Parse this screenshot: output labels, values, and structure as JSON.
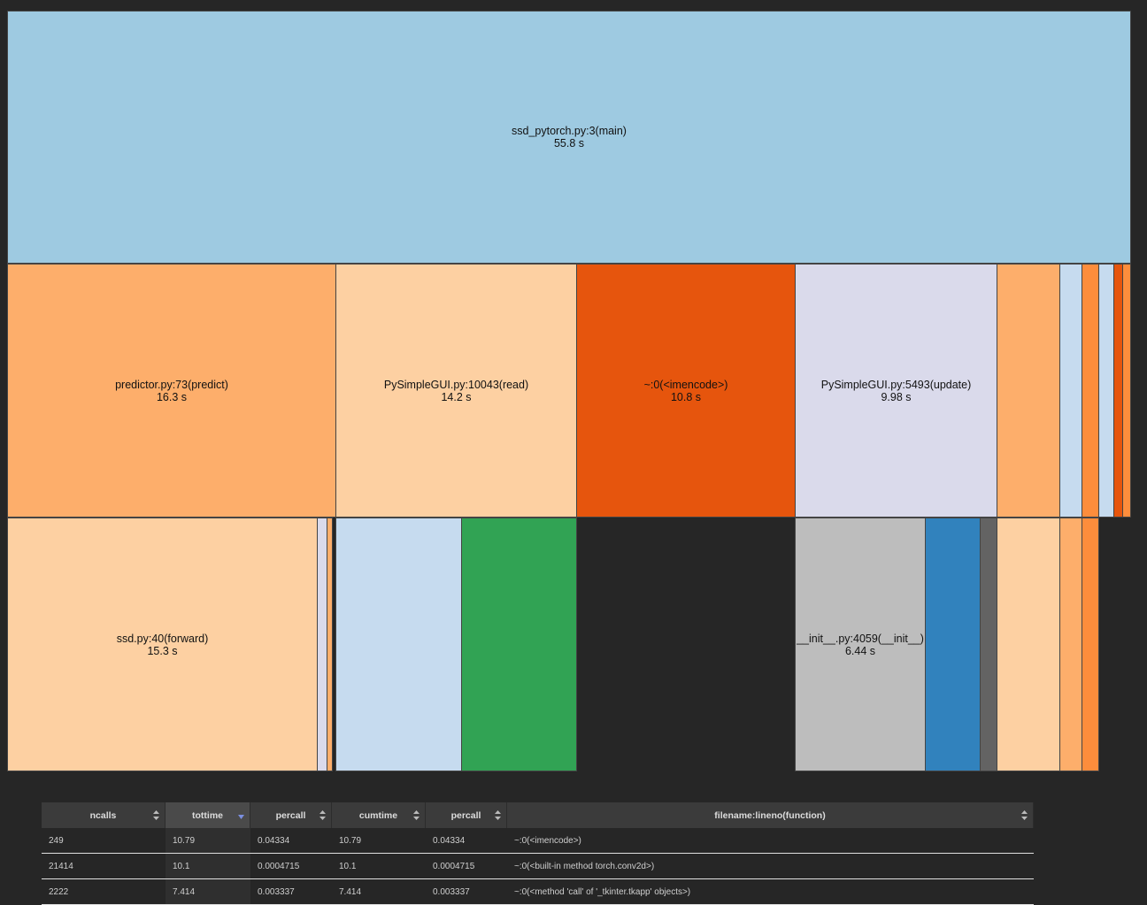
{
  "icicle": {
    "nodes": [
      {
        "id": "main",
        "label": "ssd_pytorch.py:3(main)",
        "time": "55.8 s",
        "color": "#9ecae1"
      },
      {
        "id": "predict",
        "label": "predictor.py:73(predict)",
        "time": "16.3 s",
        "color": "#fdae6b"
      },
      {
        "id": "read",
        "label": "PySimpleGUI.py:10043(read)",
        "time": "14.2 s",
        "color": "#fdd0a2"
      },
      {
        "id": "imencode",
        "label": "~:0(<imencode>)",
        "time": "10.8 s",
        "color": "#e6550d"
      },
      {
        "id": "update",
        "label": "PySimpleGUI.py:5493(update)",
        "time": "9.98 s",
        "color": "#dadaeb"
      },
      {
        "id": "forward",
        "label": "ssd.py:40(forward)",
        "time": "15.3 s",
        "color": "#fdd0a2"
      },
      {
        "id": "init",
        "label": "__init__.py:4059(__init__)",
        "time": "6.44 s",
        "color": "#bdbdbd"
      }
    ]
  },
  "stats": {
    "columns": [
      {
        "label": "ncalls",
        "sorted": false
      },
      {
        "label": "tottime",
        "sorted": true
      },
      {
        "label": "percall",
        "sorted": false
      },
      {
        "label": "cumtime",
        "sorted": false
      },
      {
        "label": "percall",
        "sorted": false
      },
      {
        "label": "filename:lineno(function)",
        "sorted": false
      }
    ],
    "rows": [
      [
        "249",
        "10.79",
        "0.04334",
        "10.79",
        "0.04334",
        "~:0(<imencode>)"
      ],
      [
        "21414",
        "10.1",
        "0.0004715",
        "10.1",
        "0.0004715",
        "~:0(<built-in method torch.conv2d>)"
      ],
      [
        "2222",
        "7.414",
        "0.003337",
        "7.414",
        "0.003337",
        "~:0(<method 'call' of '_tkinter.tkapp' objects>)"
      ]
    ]
  }
}
